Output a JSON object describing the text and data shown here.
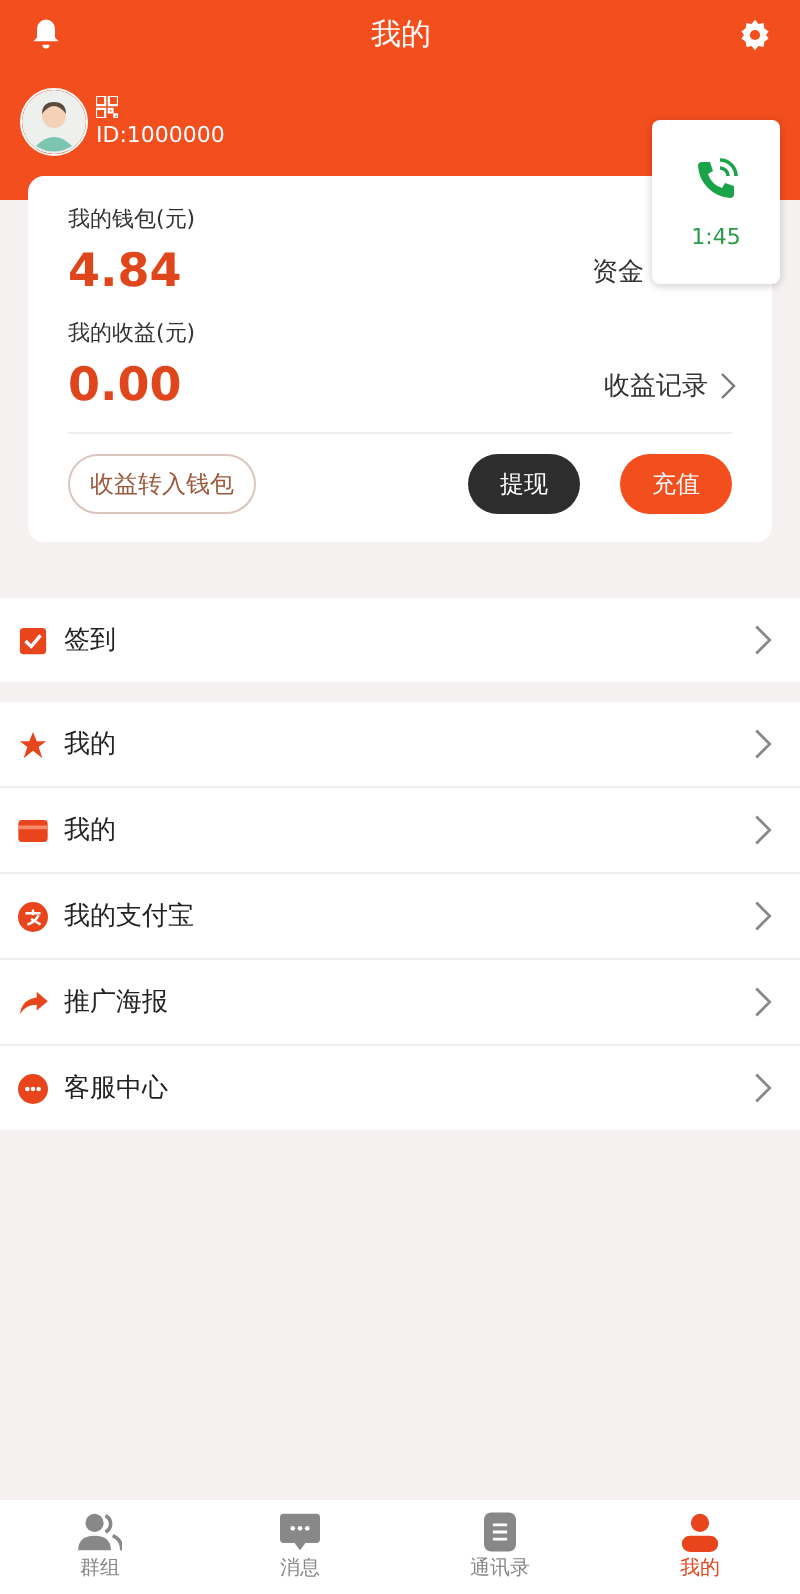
{
  "header": {
    "title": "我的"
  },
  "profile": {
    "user_id": "ID:1000000"
  },
  "wallet": {
    "label": "我的钱包(元)",
    "amount": "4.84",
    "link": "资金"
  },
  "earnings": {
    "label": "我的收益(元)",
    "amount": "0.00",
    "link": "收益记录"
  },
  "actions": [
    {
      "kind": "outline",
      "label": "收益转入钱包"
    },
    {
      "kind": "dark",
      "label": "提现"
    },
    {
      "kind": "primary",
      "label": "充值"
    }
  ],
  "call_widget": {
    "duration": "1:45"
  },
  "menu_groups": [
    [
      {
        "kind": "checkin",
        "label": "签到"
      }
    ],
    [
      {
        "kind": "star",
        "label": "我的"
      },
      {
        "kind": "card",
        "label": "我的"
      },
      {
        "kind": "alipay",
        "label": "我的支付宝"
      },
      {
        "kind": "share",
        "label": "推广海报"
      },
      {
        "kind": "service",
        "label": "客服中心"
      }
    ]
  ],
  "tabs": [
    {
      "kind": "group",
      "label": "群组",
      "selected": false
    },
    {
      "kind": "message",
      "label": "消息",
      "selected": false
    },
    {
      "kind": "contacts",
      "label": "通讯录",
      "selected": false
    },
    {
      "kind": "me",
      "label": "我的",
      "selected": true
    }
  ]
}
